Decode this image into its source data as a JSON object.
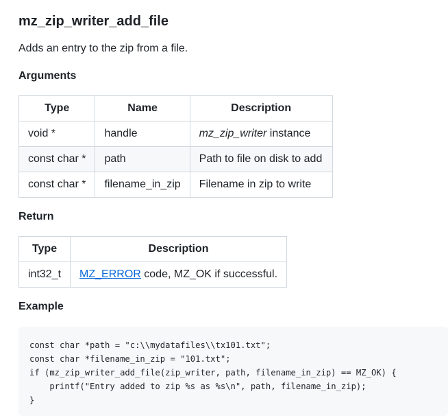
{
  "title": "mz_zip_writer_add_file",
  "description": "Adds an entry to the zip from a file.",
  "arguments": {
    "heading": "Arguments",
    "headers": [
      "Type",
      "Name",
      "Description"
    ],
    "rows": [
      {
        "type": "void *",
        "name": "handle",
        "desc_italic": "mz_zip_writer",
        "desc_rest": " instance"
      },
      {
        "type": "const char *",
        "name": "path",
        "desc_italic": "",
        "desc_rest": "Path to file on disk to add"
      },
      {
        "type": "const char *",
        "name": "filename_in_zip",
        "desc_italic": "",
        "desc_rest": "Filename in zip to write"
      }
    ]
  },
  "return": {
    "heading": "Return",
    "headers": [
      "Type",
      "Description"
    ],
    "row": {
      "type": "int32_t",
      "link": "MZ_ERROR",
      "desc_rest": " code, MZ_OK if successful."
    }
  },
  "example": {
    "heading": "Example",
    "code": "const char *path = \"c:\\\\mydatafiles\\\\tx101.txt\";\nconst char *filename_in_zip = \"101.txt\";\nif (mz_zip_writer_add_file(zip_writer, path, filename_in_zip) == MZ_OK) {\n    printf(\"Entry added to zip %s as %s\\n\", path, filename_in_zip);\n}"
  },
  "colors": {
    "link": "#0969da",
    "border": "#d0d7de",
    "code_bg": "#f6f8fa",
    "text": "#1f2328"
  }
}
